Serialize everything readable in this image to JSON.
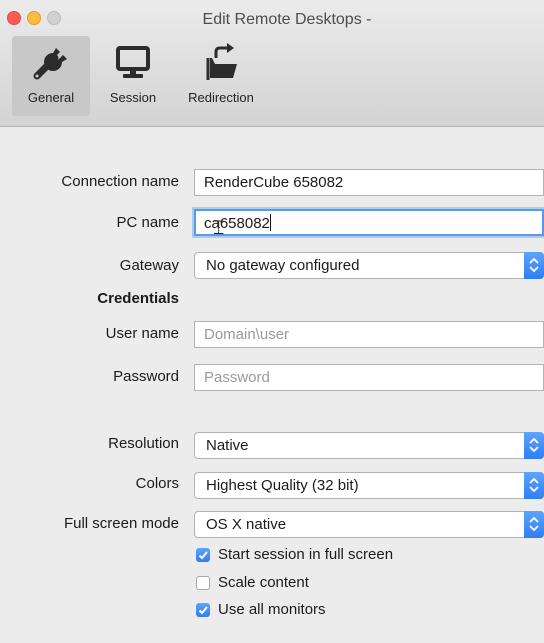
{
  "window": {
    "title": "Edit Remote Desktops -"
  },
  "toolbar": {
    "items": [
      {
        "label": "General",
        "icon": "wrench-icon",
        "selected": true
      },
      {
        "label": "Session",
        "icon": "monitor-icon",
        "selected": false
      },
      {
        "label": "Redirection",
        "icon": "folder-export-icon",
        "selected": false
      }
    ]
  },
  "form": {
    "connection_name": {
      "label": "Connection name",
      "value": "RenderCube 658082"
    },
    "pc_name": {
      "label": "PC name",
      "value": "ca658082"
    },
    "gateway": {
      "label": "Gateway",
      "value": "No gateway configured"
    },
    "credentials_heading": "Credentials",
    "user_name": {
      "label": "User name",
      "placeholder": "Domain\\user"
    },
    "password": {
      "label": "Password",
      "placeholder": "Password"
    },
    "resolution": {
      "label": "Resolution",
      "value": "Native"
    },
    "colors": {
      "label": "Colors",
      "value": "Highest Quality (32 bit)"
    },
    "full_screen_mode": {
      "label": "Full screen mode",
      "value": "OS X native"
    },
    "checkboxes": [
      {
        "label": "Start session in full screen",
        "checked": true
      },
      {
        "label": "Scale content",
        "checked": false
      },
      {
        "label": "Use all monitors",
        "checked": true
      }
    ]
  },
  "colors": {
    "accent": "#3d8bf5",
    "close": "#fc5b57",
    "minimize": "#fdbc40"
  }
}
